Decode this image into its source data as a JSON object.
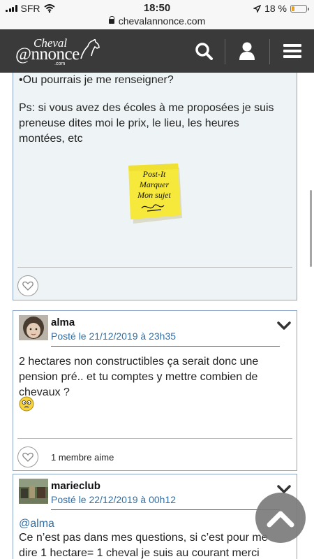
{
  "status_bar": {
    "carrier": "SFR",
    "time": "18:50",
    "battery": "18 %",
    "battery_level": 0.18
  },
  "browser": {
    "url": "chevalannonce.com"
  },
  "header": {
    "logo_top": "Cheval",
    "logo_main": "@nnonce",
    "logo_sub": ".com"
  },
  "post1": {
    "line1": "•Ou pourrais je me renseigner?",
    "line2": "Ps: si vous avez des écoles à me proposées je suis preneuse dites moi le prix, le lieu, les heures montées, etc",
    "note": [
      "Post-It",
      "Marquer",
      "Mon sujet"
    ]
  },
  "post2": {
    "author": "alma",
    "date": "Posté le 21/12/2019 à 23h35",
    "body": "2 hectares non constructibles ça serait donc une pension pré.. et tu comptes y mettre combien de chevaux ?",
    "likes": "1 membre aime"
  },
  "post3": {
    "author": "marieclub",
    "date": "Posté le 22/12/2019 à 00h12",
    "mention": "@alma",
    "body": "Ce n’est pas dans mes questions, si c’est pour me dire 1 hectare= 1 cheval je suis au courant merci"
  },
  "colors": {
    "header_bg": "#3a3a3a",
    "link_blue": "#2f6fa8",
    "post_bg": "#eef4f6",
    "note_yellow": "#f7e93c"
  }
}
